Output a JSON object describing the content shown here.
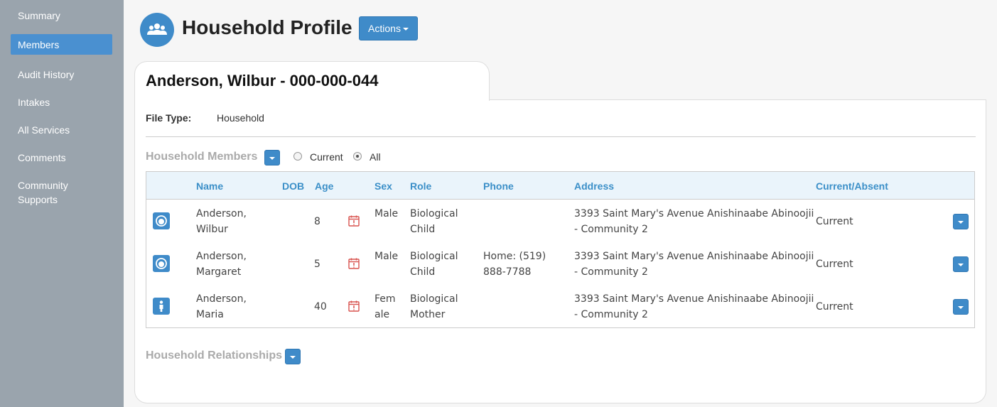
{
  "sidebar": {
    "items": [
      {
        "label": "Summary"
      },
      {
        "label": "Members"
      },
      {
        "label": "Audit History"
      },
      {
        "label": "Intakes"
      },
      {
        "label": "All Services"
      },
      {
        "label": "Comments"
      },
      {
        "label": "Community Supports"
      }
    ],
    "active_index": 1
  },
  "header": {
    "icon": "people-icon",
    "title": "Household Profile",
    "actions_label": "Actions"
  },
  "profile": {
    "tab_title": "Anderson, Wilbur - 000-000-044",
    "file_type_label": "File Type:",
    "file_type_value": "Household"
  },
  "members_section": {
    "title": "Household Members",
    "filter": {
      "current_label": "Current",
      "all_label": "All",
      "selected": "All"
    },
    "columns": [
      "Name",
      "DOB",
      "Age",
      "Sex",
      "Role",
      "Phone",
      "Address",
      "Current/Absent"
    ],
    "rows": [
      {
        "avatar_icon": "child-face-icon",
        "name_line1": "Anderson,",
        "name_line2": "Wilbur",
        "age": "8",
        "dob_icon": "calendar-alert-icon",
        "sex_line1": "Male",
        "sex_line2": "",
        "role_line1": "Biological",
        "role_line2": "Child",
        "phone_line1": "",
        "phone_line2": "",
        "address_line1": "3393 Saint Mary's Avenue Anishinaabe Abinoojii",
        "address_line2": "- Community 2",
        "status": "Current"
      },
      {
        "avatar_icon": "child-face-icon",
        "name_line1": "Anderson,",
        "name_line2": "Margaret",
        "age": "5",
        "dob_icon": "calendar-alert-icon",
        "sex_line1": "Male",
        "sex_line2": "",
        "role_line1": "Biological",
        "role_line2": "Child",
        "phone_line1": "Home: (519)",
        "phone_line2": "888-7788",
        "address_line1": "3393 Saint Mary's Avenue Anishinaabe Abinoojii",
        "address_line2": "- Community 2",
        "status": "Current"
      },
      {
        "avatar_icon": "adult-person-icon",
        "name_line1": "Anderson,",
        "name_line2": "Maria",
        "age": "40",
        "dob_icon": "calendar-alert-icon",
        "sex_line1": "Fem",
        "sex_line2": "ale",
        "role_line1": "Biological",
        "role_line2": "Mother",
        "phone_line1": "",
        "phone_line2": "",
        "address_line1": "3393 Saint Mary's Avenue Anishinaabe Abinoojii",
        "address_line2": "- Community 2",
        "status": "Current"
      }
    ]
  },
  "relationships_section": {
    "title": "Household Relationships"
  },
  "colors": {
    "sidebar_bg": "#9aa4ad",
    "accent": "#3f8bc9",
    "header_text": "#3b8fc8",
    "alert_red": "#d9534f"
  }
}
